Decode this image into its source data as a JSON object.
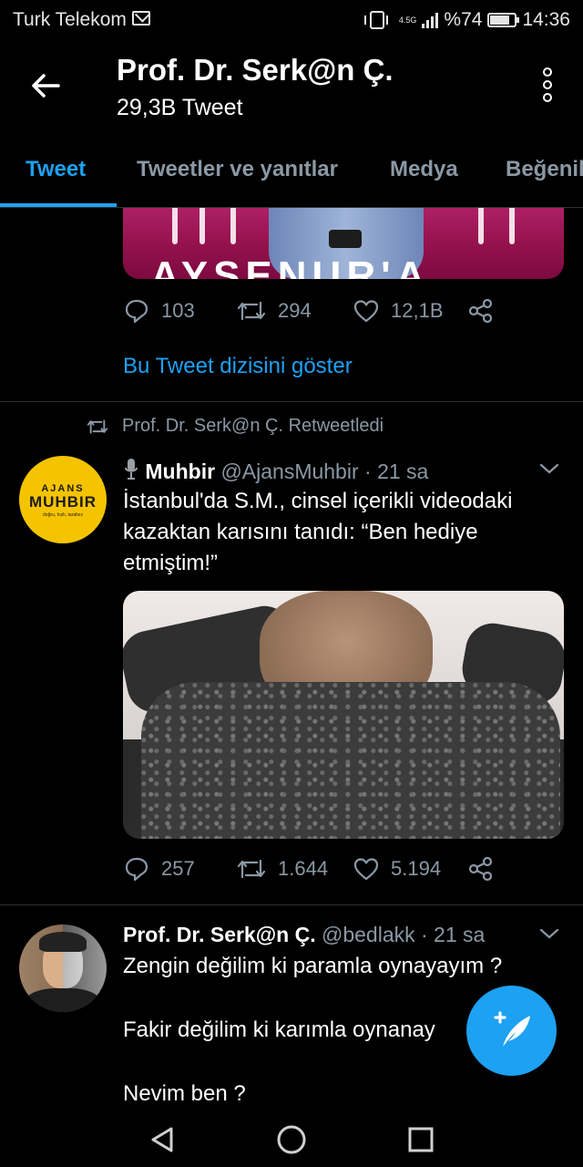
{
  "status_bar": {
    "carrier": "Turk Telekom",
    "network": "4.5G",
    "battery_percent": "%74",
    "battery_level": 0.74,
    "time": "14:36"
  },
  "header": {
    "title": "Prof. Dr. Serk@n Ç.",
    "subtitle": "29,3B Tweet"
  },
  "tabs": [
    {
      "label": "Tweet",
      "active": true
    },
    {
      "label": "Tweetler ve yanıtlar",
      "active": false
    },
    {
      "label": "Medya",
      "active": false
    },
    {
      "label": "Beğeniler",
      "active": false
    }
  ],
  "tweet1": {
    "media_text": "AYSENUR'A",
    "replies": "103",
    "retweets": "294",
    "likes": "12,1B",
    "show_thread": "Bu Tweet dizisini göster"
  },
  "tweet2": {
    "retweeted_by": "Prof. Dr. Serk@n Ç. Retweetledi",
    "avatar_text_top": "AJANS",
    "avatar_text_main": "MUHBIR",
    "avatar_text_small": "doğru, hızlı, tarafsız",
    "name": "Muhbir",
    "handle": "@AjansMuhbir",
    "time": "· 21 sa",
    "text_lines": [
      "İstanbul'da S.M., cinsel içerikli videodaki",
      "kazaktan karısını tanıdı: “Ben hediye",
      "etmiştim!”"
    ],
    "replies": "257",
    "retweets": "1.644",
    "likes": "5.194"
  },
  "tweet3": {
    "name": "Prof. Dr. Serk@n Ç.",
    "handle": "@bedlakk",
    "time": "· 21 sa",
    "line1": "Zengin değilim ki paramla oynayayım ?",
    "line2": "Fakir değilim ki karımla oynanay",
    "line3": "Nevim ben ?"
  },
  "colors": {
    "accent": "#1da1f2",
    "muted": "#8b98a5",
    "background": "#000000"
  }
}
